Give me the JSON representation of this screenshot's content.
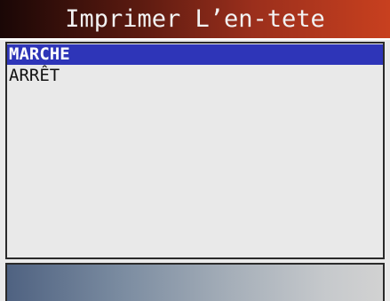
{
  "header": {
    "title": "Imprimer L’en-tete"
  },
  "menu": {
    "items": [
      {
        "label": "MARCHE",
        "selected": true
      },
      {
        "label": "ARRÊT",
        "selected": false
      }
    ]
  },
  "colors": {
    "title_bar_start": "#1a0706",
    "title_bar_end": "#c8401f",
    "selection": "#2e35b8",
    "panel_background": "#e9e9e9",
    "status_bar_start": "#4f6281",
    "status_bar_end": "#d2d2d2"
  }
}
